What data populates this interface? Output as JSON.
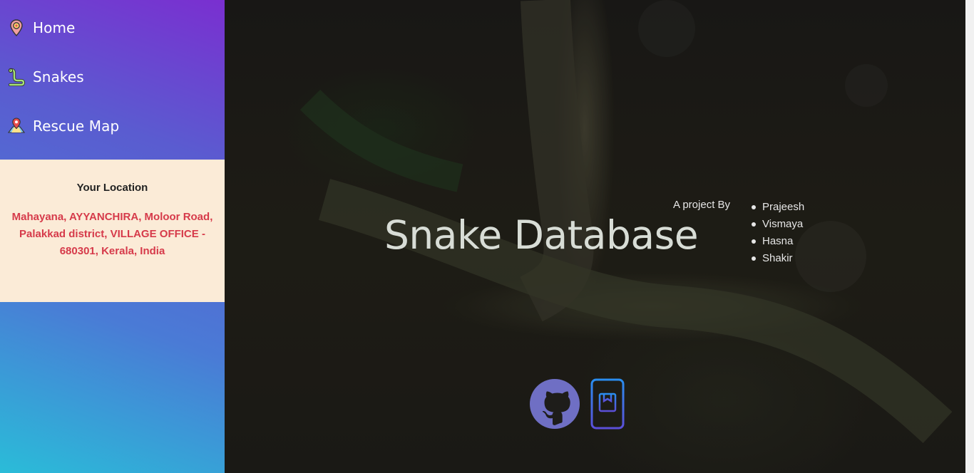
{
  "sidebar": {
    "items": [
      {
        "label": "Home",
        "icon": "location-pin-icon"
      },
      {
        "label": "Snakes",
        "icon": "snake-icon"
      },
      {
        "label": "Rescue Map",
        "icon": "map-icon"
      }
    ],
    "location": {
      "title": "Your Location",
      "address": "Mahayana, AYYANCHIRA, Moloor Road, Palakkad district, VILLAGE OFFICE - 680301, Kerala, India"
    }
  },
  "hero": {
    "title": "Snake Database",
    "byline": "A project By",
    "authors": [
      "Prajeesh",
      "Vismaya",
      "Hasna",
      "Shakir"
    ],
    "links": [
      {
        "icon": "github-icon"
      },
      {
        "icon": "mobile-app-icon"
      }
    ]
  },
  "colors": {
    "sidebar_top": "#7a2fd0",
    "sidebar_bottom": "#2abcd8",
    "location_bg": "#fbebd7",
    "address_text": "#d63a4a",
    "github": "#6f6fc4",
    "app_icon_top": "#2a8ef0",
    "app_icon_bottom": "#5b4fd8"
  }
}
